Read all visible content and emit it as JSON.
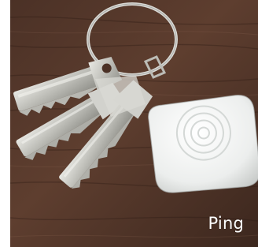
{
  "photo": {
    "subject": "keys-and-tracker",
    "caption": "Ping"
  },
  "colors": {
    "wood_dark": "#3a251c",
    "wood_mid": "#5a3b2c",
    "wood_light": "#7a5544",
    "key_silver": "#c9c9c4",
    "tracker_white": "#eef0ef",
    "caption_text": "#ffffff"
  }
}
